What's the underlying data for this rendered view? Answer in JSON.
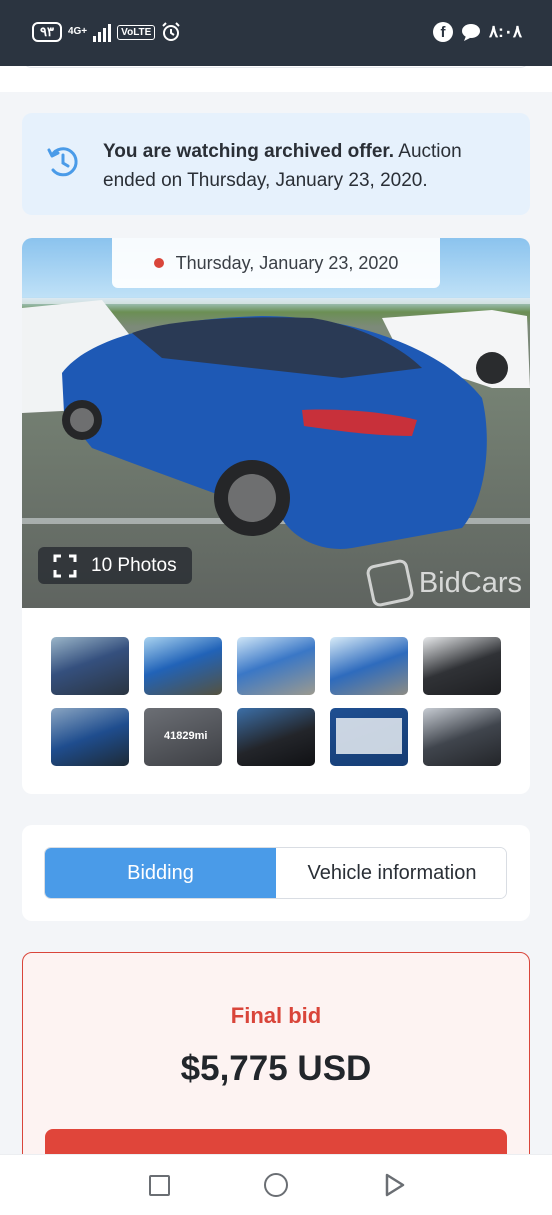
{
  "status_bar": {
    "battery": "٩٣",
    "network": "4G+",
    "volte": "VoLTE",
    "time": "٨:٠٨"
  },
  "archive_notice": {
    "bold_text": "You are watching archived offer.",
    "text": " Auction ended on Thursday, January 23, 2020."
  },
  "gallery": {
    "date": "Thursday, January 23, 2020",
    "photos_count": "10 Photos",
    "watermark": "BidCars",
    "odometer_thumb": "41829mi"
  },
  "tabs": [
    {
      "label": "Bidding",
      "active": true
    },
    {
      "label": "Vehicle information",
      "active": false
    }
  ],
  "bid": {
    "label": "Final bid",
    "amount": "$5,775 USD"
  },
  "colors": {
    "accent": "#4a9be8",
    "danger": "#d9453a",
    "notice_bg": "#e6f1fc"
  }
}
